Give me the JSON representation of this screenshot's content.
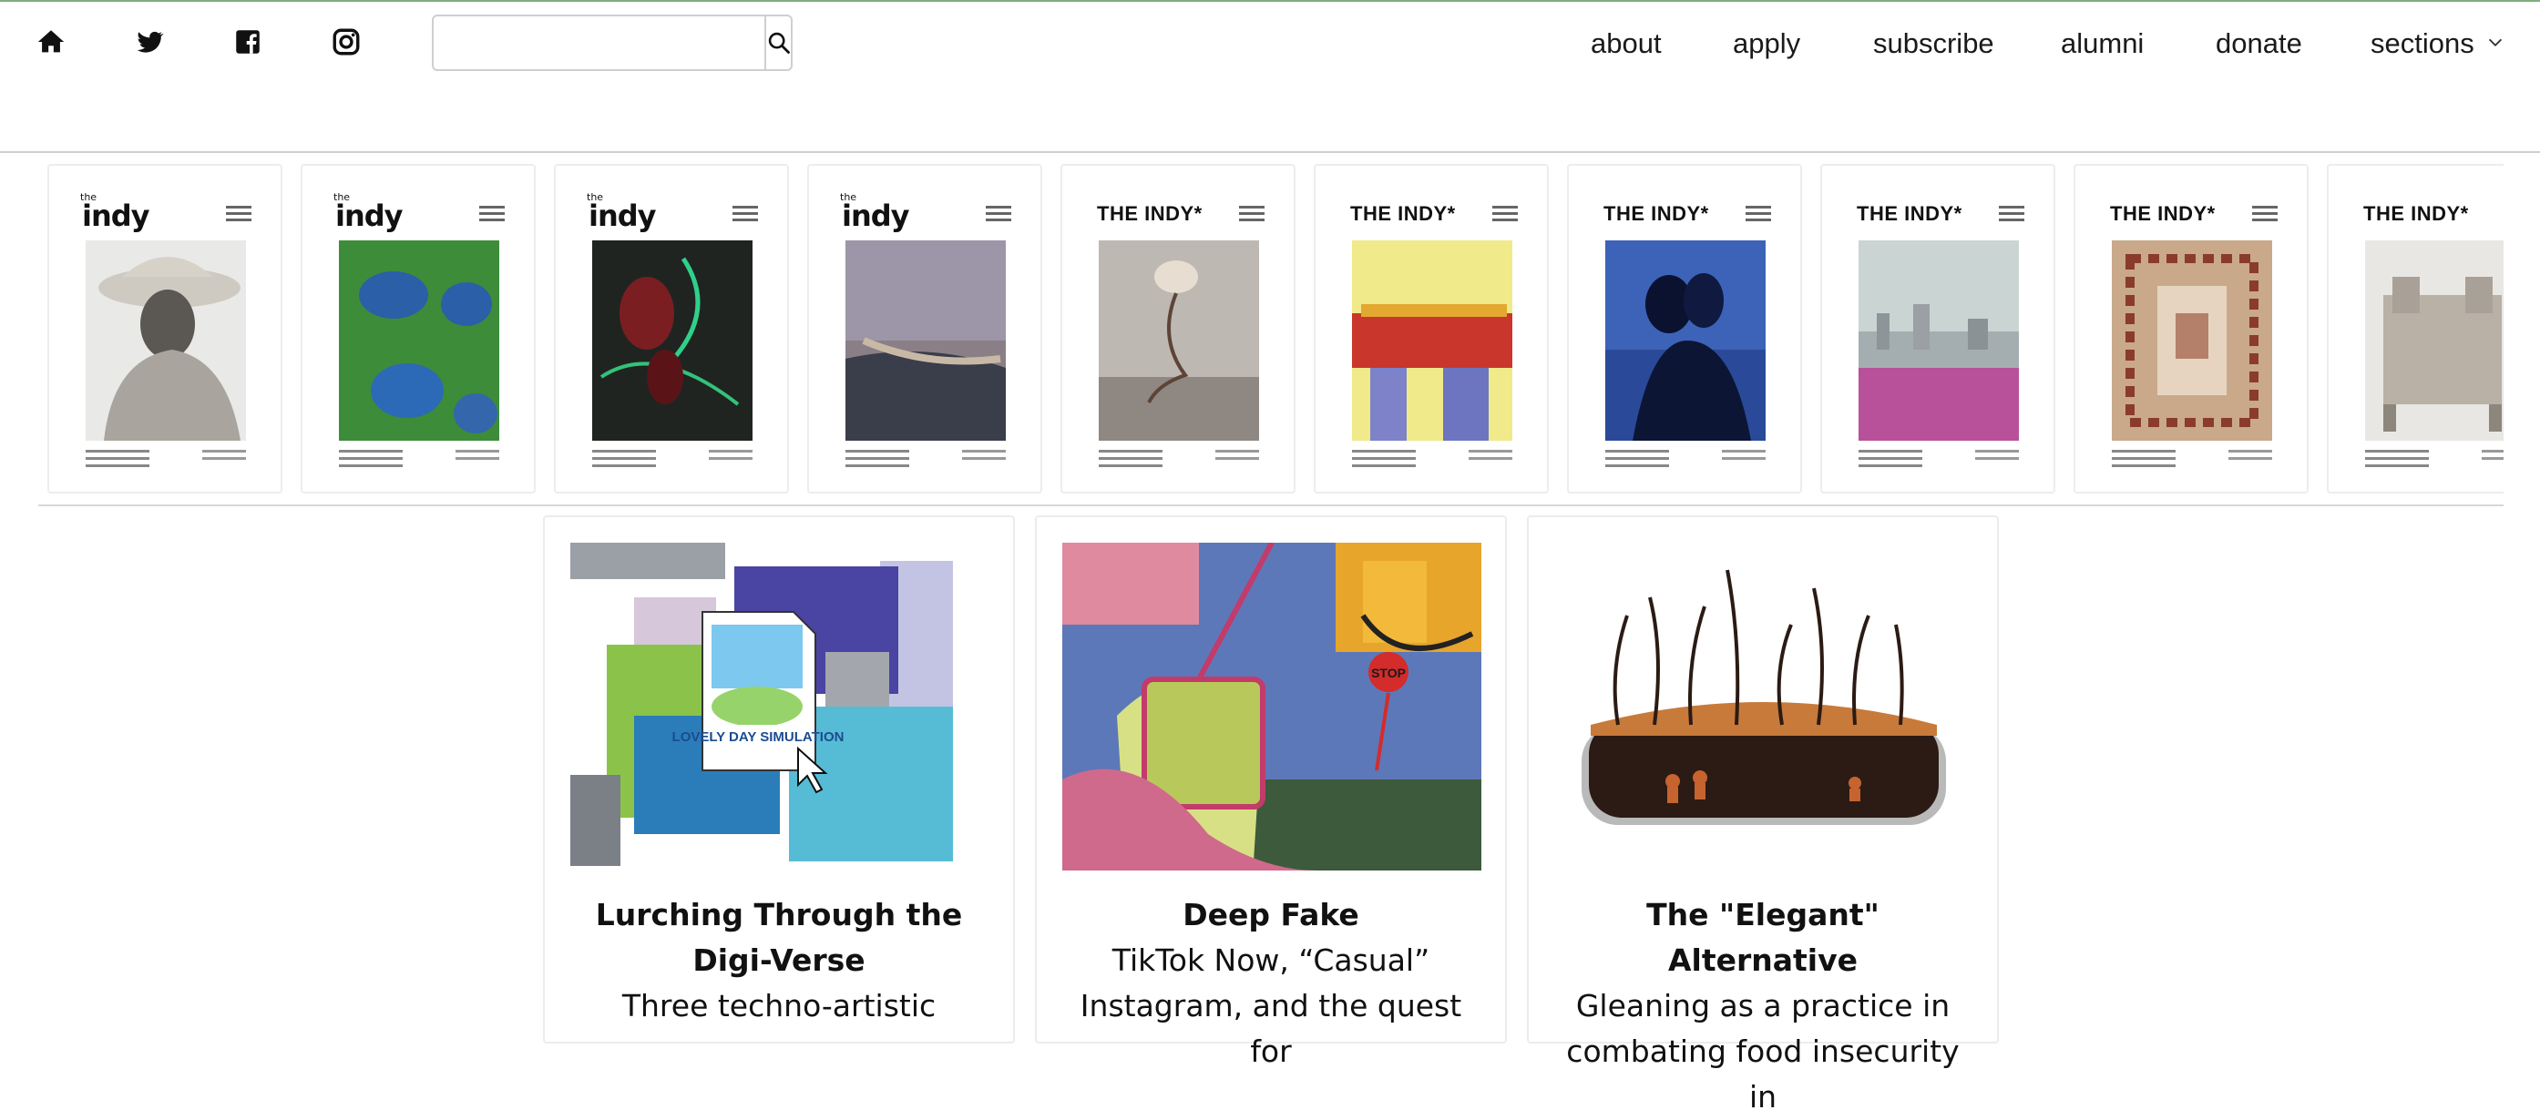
{
  "nav": {
    "items": [
      {
        "label": "about"
      },
      {
        "label": "apply"
      },
      {
        "label": "subscribe"
      },
      {
        "label": "alumni"
      },
      {
        "label": "donate"
      },
      {
        "label": "sections"
      }
    ],
    "search_placeholder": ""
  },
  "issues": [
    {
      "masthead": "indy",
      "masthead_prefix": "the",
      "style": "small"
    },
    {
      "masthead": "indy",
      "masthead_prefix": "the",
      "style": "small"
    },
    {
      "masthead": "indy",
      "masthead_prefix": "the",
      "style": "small"
    },
    {
      "masthead": "indy",
      "masthead_prefix": "the",
      "style": "small"
    },
    {
      "masthead": "THE INDY*",
      "style": "big"
    },
    {
      "masthead": "THE INDY*",
      "style": "big"
    },
    {
      "masthead": "THE INDY*",
      "style": "big"
    },
    {
      "masthead": "THE INDY*",
      "style": "big"
    },
    {
      "masthead": "THE INDY*",
      "style": "big"
    },
    {
      "masthead": "THE INDY*",
      "style": "big"
    }
  ],
  "articles": [
    {
      "title": "Lurching Through the Digi-Verse",
      "dek": "Three techno-artistic",
      "art_text": "LOVELY DAY SIMULATION"
    },
    {
      "title": "Deep Fake",
      "dek": "TikTok Now, “Casual” Instagram, and the quest for",
      "art_text": "STOP"
    },
    {
      "title": "The \"Elegant\" Alternative",
      "dek": "Gleaning as a practice in combating food insecurity in"
    }
  ],
  "colors": {
    "accent_top_border": "#7fae7f",
    "divider": "#d8d8d8",
    "card_border": "#ececec"
  }
}
